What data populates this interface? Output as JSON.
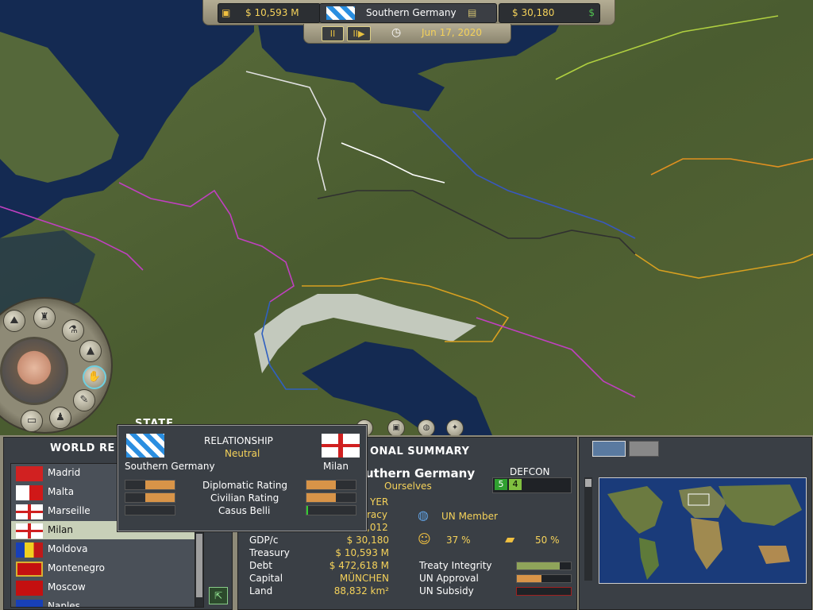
{
  "topbar": {
    "money": "$ 10,593 M",
    "country": "Southern Germany",
    "gdp_per_capita": "$ 30,180",
    "pause_label": "II",
    "play_label": "II▶",
    "date": "Jun 17, 2020"
  },
  "state_label": "STATE",
  "world_relations": {
    "title": "WORLD RE",
    "items": [
      {
        "name": "Madrid",
        "flag": "#d12121"
      },
      {
        "name": "Malta",
        "flag": "#ffffff"
      },
      {
        "name": "Marseille",
        "flag": "#1f5ac8"
      },
      {
        "name": "Milan",
        "flag": "#ffffff",
        "selected": true
      },
      {
        "name": "Moldova",
        "flag": "#1840b8"
      },
      {
        "name": "Montenegro",
        "flag": "#c41010"
      },
      {
        "name": "Moscow",
        "flag": "#c41010"
      },
      {
        "name": "Naples",
        "flag": "#1840b8"
      }
    ]
  },
  "relationship": {
    "title": "RELATIONSHIP",
    "status": "Neutral",
    "left_country": "Southern Germany",
    "right_country": "Milan",
    "rows": [
      {
        "label": "Diplomatic Rating",
        "left": 0.6,
        "right": 0.6
      },
      {
        "label": "Civilian Rating",
        "left": 0.6,
        "right": 0.6
      },
      {
        "label": "Casus Belli",
        "left": 0,
        "right": 0
      }
    ]
  },
  "national_summary": {
    "title": "ONAL SUMMARY",
    "country": "uthern Germany",
    "relation": "Ourselves",
    "partial_1": "YER",
    "partial_2": "racy",
    "partial_3": ",012",
    "stats": [
      {
        "label": "GDP/c",
        "value": "$ 30,180"
      },
      {
        "label": "Treasury",
        "value": "$ 10,593 M"
      },
      {
        "label": "Debt",
        "value": "$ 472,618 M"
      },
      {
        "label": "Capital",
        "value": "MÜNCHEN"
      },
      {
        "label": "Land",
        "value": "88,832 km²"
      }
    ],
    "defcon_label": "DEFCON",
    "defcon_values": [
      "5",
      "4"
    ],
    "un_member": "UN Member",
    "pct_1": "37 %",
    "pct_2": "50 %",
    "treaty_integrity": "Treaty Integrity",
    "un_approval": "UN Approval",
    "un_subsidy": "UN Subsidy",
    "treaty_integrity_level": 0.8,
    "un_approval_level": 0.45,
    "un_subsidy_level": 0
  },
  "colors": {
    "accent_yellow": "#f5d25a",
    "bar_green": "#8fa45a",
    "bar_orange": "#d89448",
    "sea": "#142a52"
  }
}
